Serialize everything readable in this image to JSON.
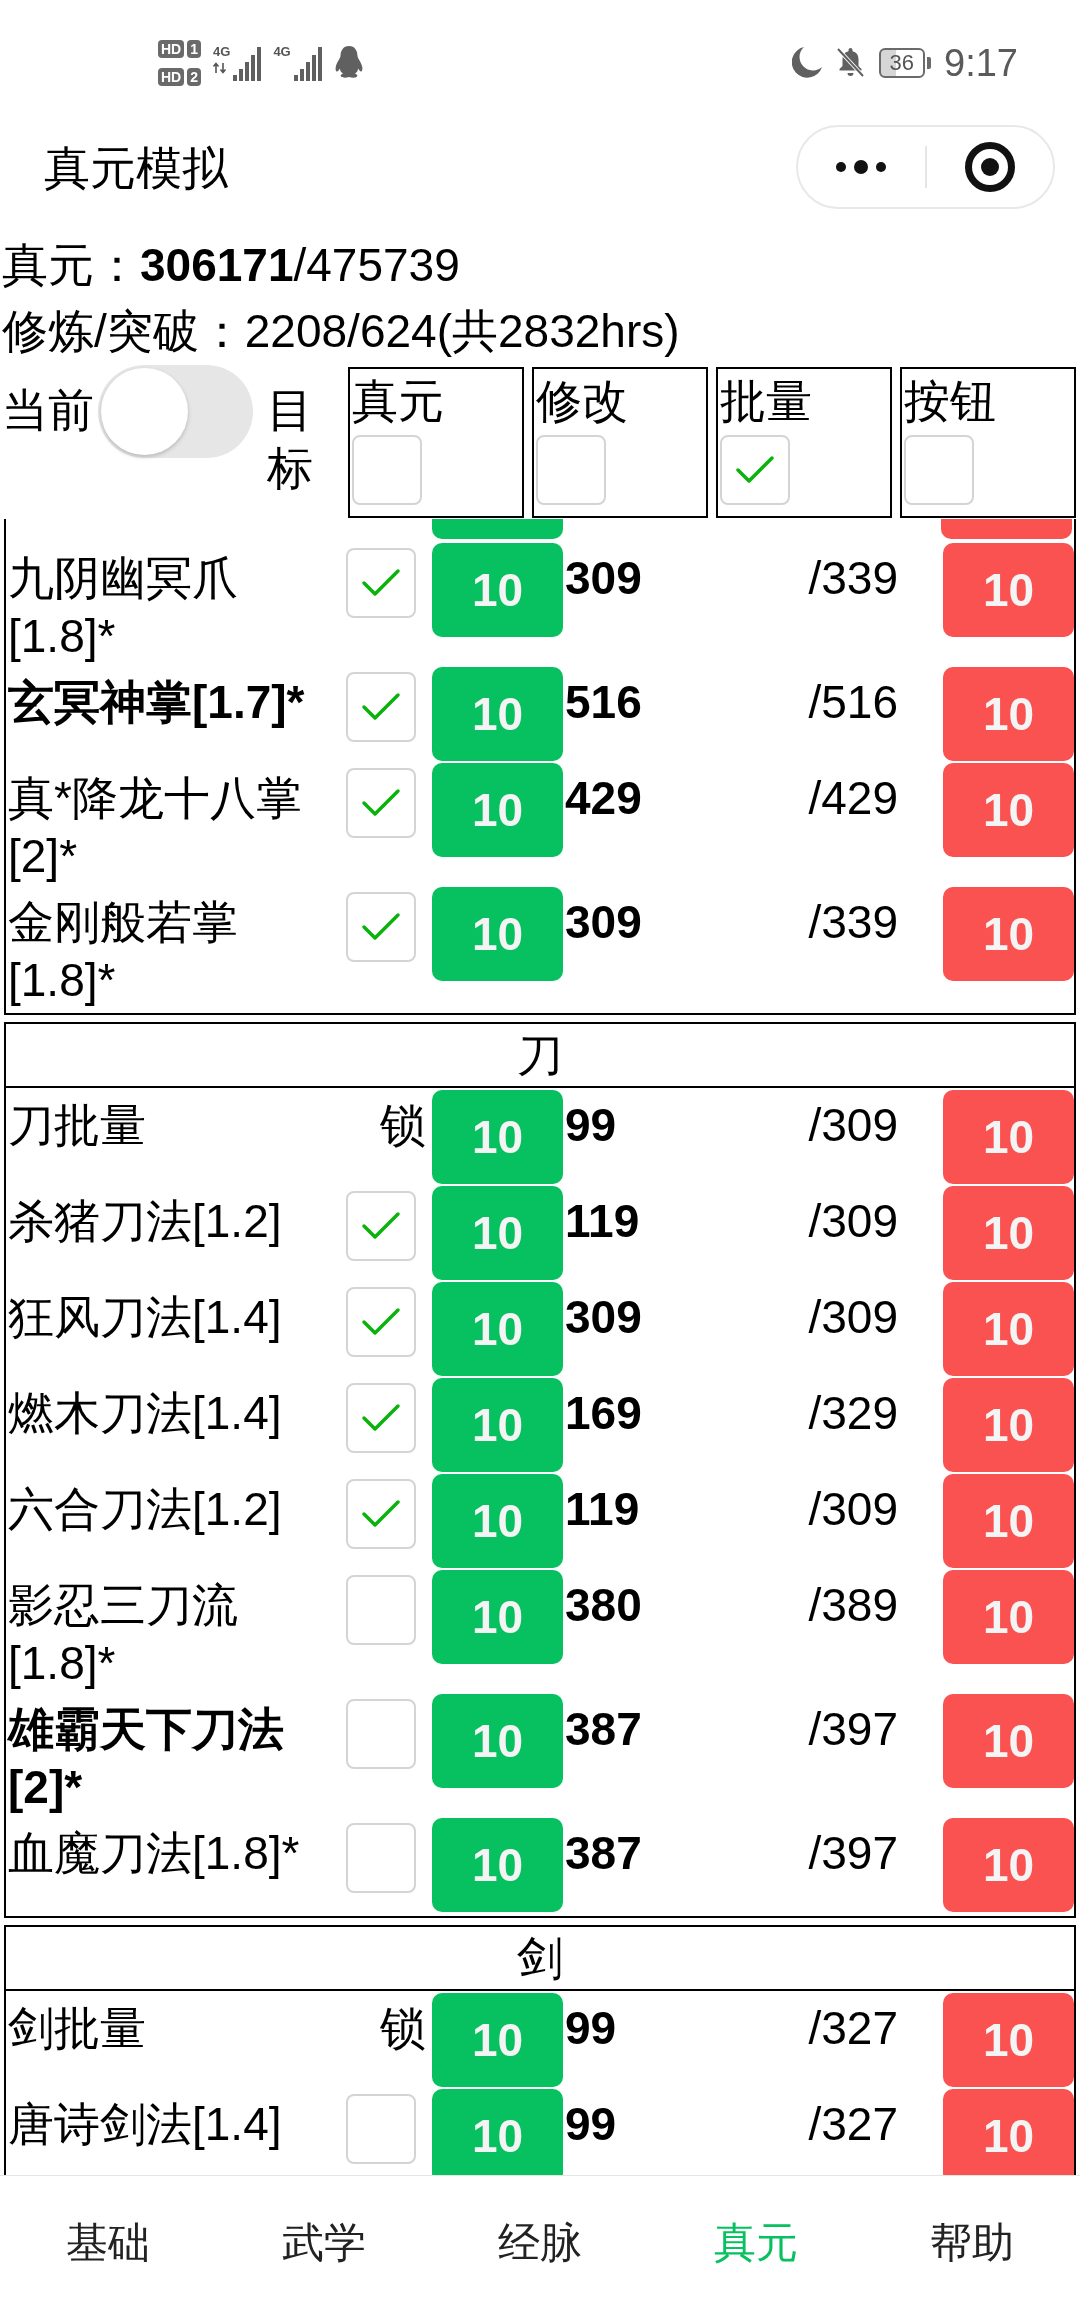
{
  "status_bar": {
    "sims": [
      {
        "badge": "HD",
        "slot": "1"
      },
      {
        "badge": "HD",
        "slot": "2"
      }
    ],
    "networks": [
      {
        "label": "4G",
        "data_arrows": true
      },
      {
        "label": "4G",
        "data_arrows": false
      }
    ],
    "battery": "36",
    "time": "9:17"
  },
  "header": {
    "title": "真元模拟"
  },
  "summary": [
    "真元：**306171**/475739",
    "修炼/突破：2208/624(共2832hrs)"
  ],
  "mode": {
    "left_label": "当前",
    "right_label": "目标",
    "on": false
  },
  "toggles": [
    {
      "label": "真元",
      "checked": false
    },
    {
      "label": "修改",
      "checked": false
    },
    {
      "label": "批量",
      "checked": true
    },
    {
      "label": "按钮",
      "checked": false
    }
  ],
  "sections": [
    {
      "clipped_above": true,
      "rows": [
        {
          "kind": "skill",
          "name": "九阴幽冥爪[1.8]*",
          "bold": false,
          "checked": true,
          "add": "10",
          "value": "309",
          "max": "/339",
          "subtract": "10"
        },
        {
          "kind": "skill",
          "name": "玄冥神掌[1.7]*",
          "bold": true,
          "checked": true,
          "add": "10",
          "value": "516",
          "max": "/516",
          "subtract": "10"
        },
        {
          "kind": "skill",
          "name": "真*降龙十八掌[2]*",
          "bold": false,
          "checked": true,
          "add": "10",
          "value": "429",
          "max": "/429",
          "subtract": "10"
        },
        {
          "kind": "skill",
          "name": "金刚般若掌[1.8]*",
          "bold": false,
          "checked": true,
          "add": "10",
          "value": "309",
          "max": "/339",
          "subtract": "10"
        }
      ]
    },
    {
      "title": "刀",
      "rows": [
        {
          "kind": "batch",
          "name": "刀批量",
          "bold": false,
          "lock": "锁",
          "add": "10",
          "value": "99",
          "max": "/309",
          "subtract": "10"
        },
        {
          "kind": "skill",
          "name": "杀猪刀法[1.2]",
          "bold": false,
          "checked": true,
          "add": "10",
          "value": "119",
          "max": "/309",
          "subtract": "10"
        },
        {
          "kind": "skill",
          "name": "狂风刀法[1.4]",
          "bold": false,
          "checked": true,
          "add": "10",
          "value": "309",
          "max": "/309",
          "subtract": "10"
        },
        {
          "kind": "skill",
          "name": "燃木刀法[1.4]",
          "bold": false,
          "checked": true,
          "add": "10",
          "value": "169",
          "max": "/329",
          "subtract": "10"
        },
        {
          "kind": "skill",
          "name": "六合刀法[1.2]",
          "bold": false,
          "checked": true,
          "add": "10",
          "value": "119",
          "max": "/309",
          "subtract": "10"
        },
        {
          "kind": "skill",
          "name": "影忍三刀流[1.8]*",
          "bold": false,
          "checked": false,
          "add": "10",
          "value": "380",
          "max": "/389",
          "subtract": "10"
        },
        {
          "kind": "skill",
          "name": "雄霸天下刀法[2]*",
          "bold": true,
          "checked": false,
          "add": "10",
          "value": "387",
          "max": "/397",
          "subtract": "10"
        },
        {
          "kind": "skill",
          "name": "血魔刀法[1.8]*",
          "bold": false,
          "checked": false,
          "add": "10",
          "value": "387",
          "max": "/397",
          "subtract": "10"
        }
      ]
    },
    {
      "title": "剑",
      "rows": [
        {
          "kind": "batch",
          "name": "剑批量",
          "bold": false,
          "lock": "锁",
          "add": "10",
          "value": "99",
          "max": "/327",
          "subtract": "10"
        },
        {
          "kind": "skill",
          "name": "唐诗剑法[1.4]",
          "bold": false,
          "checked": false,
          "add": "10",
          "value": "99",
          "max": "/327",
          "subtract": "10"
        }
      ]
    }
  ],
  "tabs": [
    {
      "label": "基础",
      "selected": false
    },
    {
      "label": "武学",
      "selected": false
    },
    {
      "label": "经脉",
      "selected": false
    },
    {
      "label": "真元",
      "selected": true
    },
    {
      "label": "帮助",
      "selected": false
    }
  ]
}
